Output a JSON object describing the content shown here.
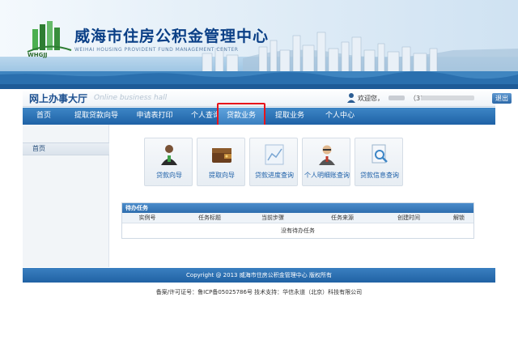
{
  "header": {
    "site_title": "威海市住房公积金管理中心",
    "site_subtitle": "WEIHAI HOUSING PROVIDENT FUND MANAGEMENT CENTER",
    "logo_text": "WHGJJ"
  },
  "hall": {
    "title": "网上办事大厅",
    "subtitle": "Online business hall",
    "welcome": "欢迎您，",
    "phone_prefix": "（37",
    "logout_label": "退出"
  },
  "nav": {
    "items": [
      {
        "label": "首页"
      },
      {
        "label": "提取贷款向导"
      },
      {
        "label": "申请表打印"
      },
      {
        "label": "个人查询"
      },
      {
        "label": "贷款业务"
      },
      {
        "label": "提取业务"
      },
      {
        "label": "个人中心"
      }
    ],
    "active_index": 4
  },
  "sidebar": {
    "items": [
      {
        "label": "首页"
      }
    ]
  },
  "functions": [
    {
      "label": "贷款向导",
      "icon": "person-icon"
    },
    {
      "label": "提取向导",
      "icon": "wallet-icon"
    },
    {
      "label": "贷款进度查询",
      "icon": "chart-icon"
    },
    {
      "label": "个人明细账查询",
      "icon": "person-glasses-icon"
    },
    {
      "label": "贷款信息查询",
      "icon": "document-search-icon"
    }
  ],
  "tasks": {
    "title": "待办任务",
    "columns": [
      "实例号",
      "任务标题",
      "当前步骤",
      "任务来源",
      "创建时间",
      "解锁"
    ],
    "empty_text": "没有待办任务"
  },
  "footer": {
    "copyright": "Copyright @ 2013 威海市住房公积金管理中心 版权所有",
    "record": "备案/许可证号：鲁ICP备05025786号 技术支持：华信永道（北京）科技有限公司"
  },
  "colors": {
    "accent": "#1f62a6",
    "highlight": "#e8141b"
  }
}
